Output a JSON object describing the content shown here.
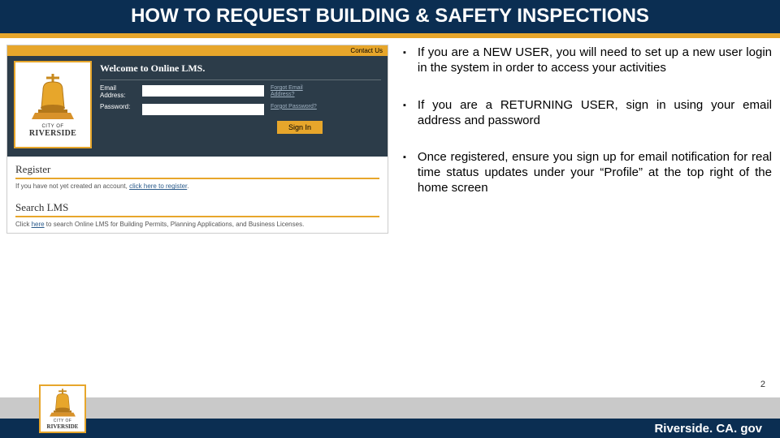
{
  "title": "HOW TO REQUEST BUILDING & SAFETY INSPECTIONS",
  "screenshot": {
    "contactUs": "Contact Us",
    "logo": {
      "cityOf": "CITY OF",
      "name": "RIVERSIDE"
    },
    "welcome": "Welcome to Online LMS.",
    "emailLabel": "Email Address:",
    "passwordLabel": "Password:",
    "emailHint": "Forgot Email Address?",
    "passwordHint": "Forgot Password?",
    "signIn": "Sign In",
    "register": {
      "title": "Register",
      "textPrefix": "If you have not yet created an account, ",
      "link": "click here to register",
      "textSuffix": "."
    },
    "search": {
      "title": "Search LMS",
      "textPrefix": "Click ",
      "link": "here",
      "textSuffix": " to search Online LMS for Building Permits, Planning Applications, and Business Licenses."
    }
  },
  "bullets": [
    "If you are a NEW USER, you will need to set up a new user login in the system in order to access your activities",
    "If you are a RETURNING USER, sign in using your email address and password",
    "Once registered, ensure you sign up for email notification for real time status updates under your “Profile” at the top right of the home screen"
  ],
  "pageNumber": "2",
  "footerUrl": "Riverside. CA. gov"
}
